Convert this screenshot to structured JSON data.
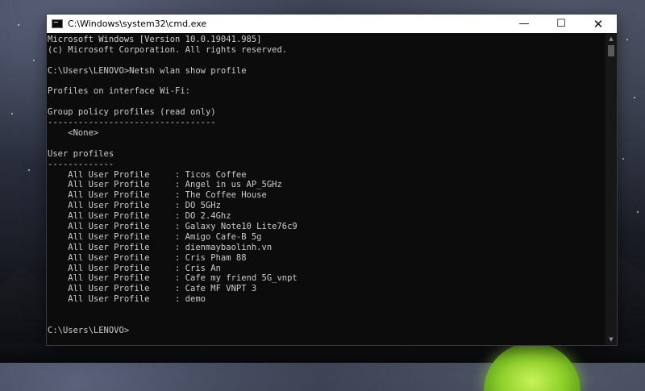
{
  "window": {
    "title": "C:\\Windows\\system32\\cmd.exe",
    "minimize_glyph": "—",
    "maximize_glyph": "☐",
    "close_glyph": "✕"
  },
  "console": {
    "lines": [
      "Microsoft Windows [Version 10.0.19041.985]",
      "(c) Microsoft Corporation. All rights reserved.",
      "",
      "C:\\Users\\LENOVO>Netsh wlan show profile",
      "",
      "Profiles on interface Wi-Fi:",
      "",
      "Group policy profiles (read only)",
      "---------------------------------",
      "    <None>",
      "",
      "User profiles",
      "-------------",
      "    All User Profile     : Ticos Coffee",
      "    All User Profile     : Angel in us AP_5GHz",
      "    All User Profile     : The Coffee House",
      "    All User Profile     : DO 5GHz",
      "    All User Profile     : DO 2.4Ghz",
      "    All User Profile     : Galaxy Note10 Lite76c9",
      "    All User Profile     : Amigo Cafe-B 5g",
      "    All User Profile     : dienmaybaolinh.vn",
      "    All User Profile     : Cris Pham 88",
      "    All User Profile     : Cris An",
      "    All User Profile     : Cafe my friend 5G_vnpt",
      "    All User Profile     : Cafe MF VNPT 3",
      "    All User Profile     : demo",
      "",
      "",
      "C:\\Users\\LENOVO>"
    ]
  },
  "scrollbar": {
    "up_glyph": "▲",
    "down_glyph": "▼"
  },
  "icons": {
    "app": "cmd-app-icon",
    "minimize": "minimize-icon",
    "maximize": "maximize-icon",
    "close": "close-icon"
  }
}
